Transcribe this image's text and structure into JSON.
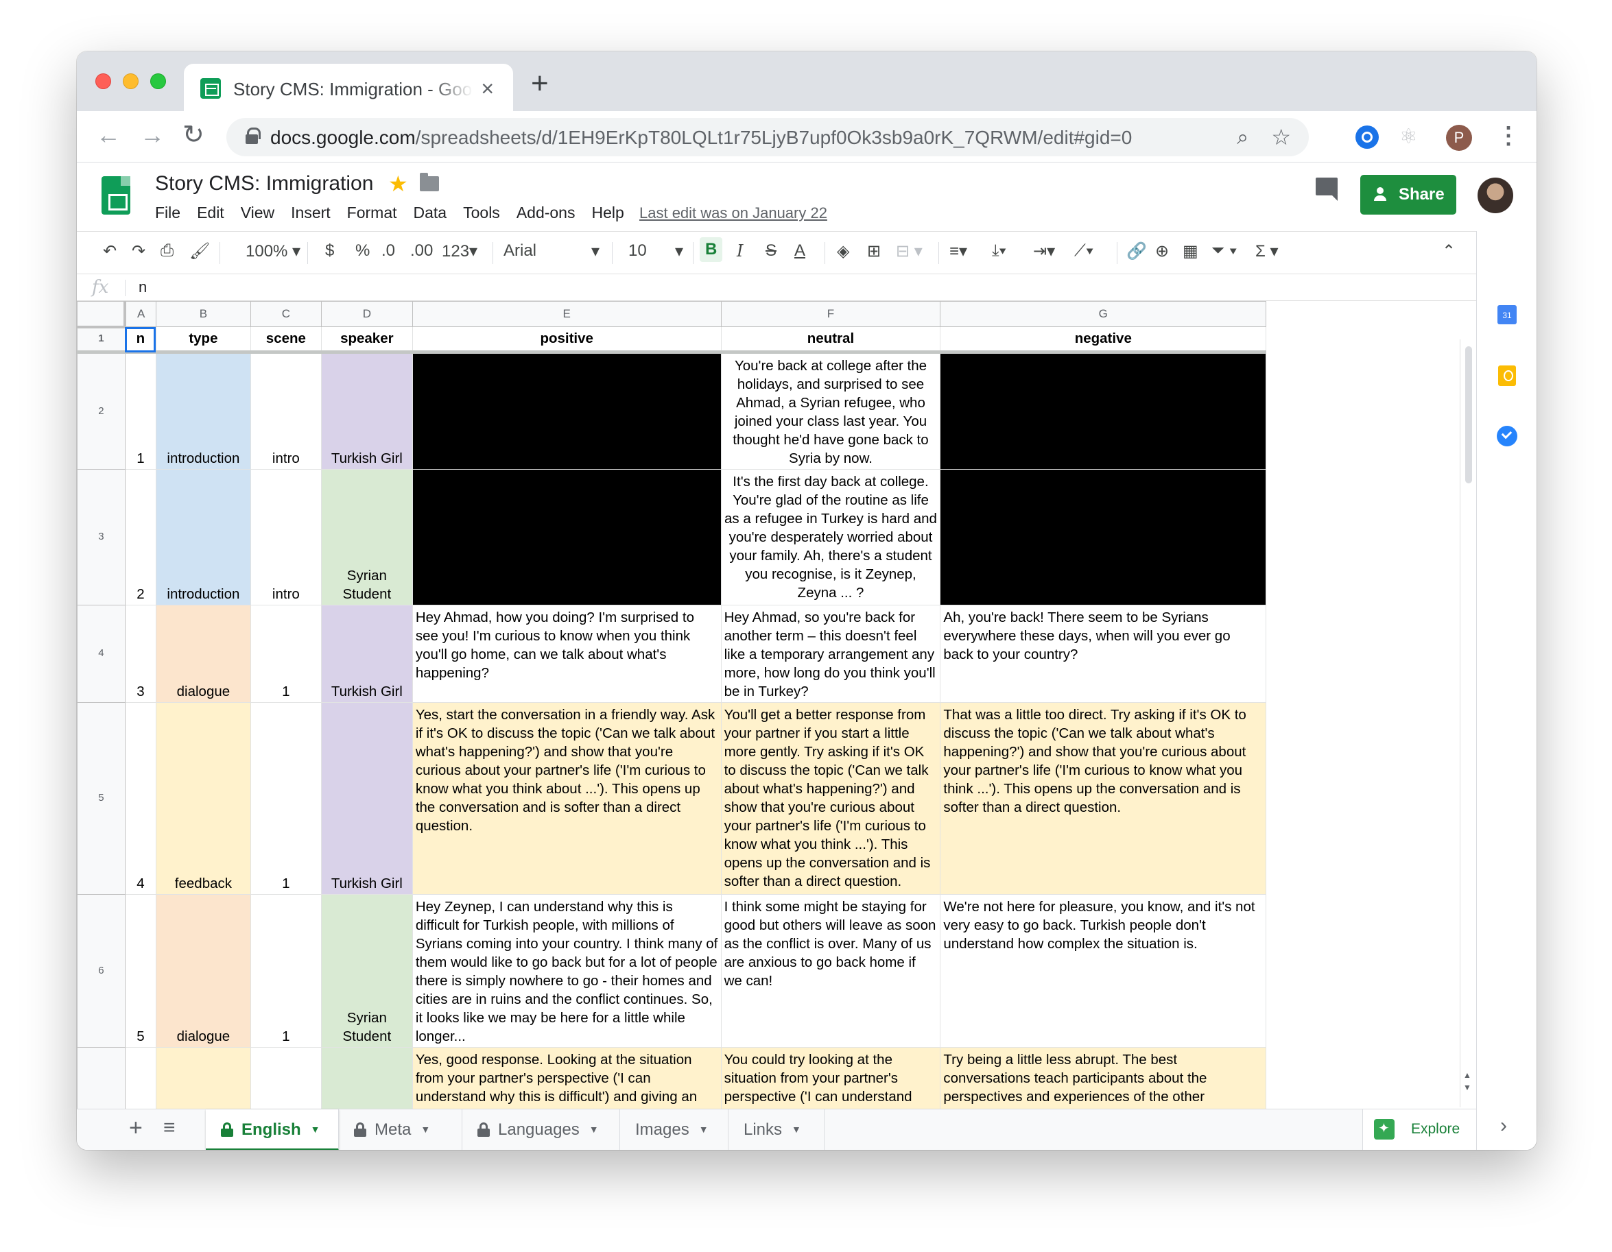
{
  "browser": {
    "tab_title": "Story CMS: Immigration - Google Sheets",
    "url_host": "docs.google.com",
    "url_path": "/spreadsheets/d/1EH9ErKpT80LQLt1r75LjyB7upf0Ok3sb9a0rK_7QRWM/edit#gid=0",
    "profile_initial": "P"
  },
  "doc": {
    "title": "Story CMS: Immigration",
    "menu": [
      "File",
      "Edit",
      "View",
      "Insert",
      "Format",
      "Data",
      "Tools",
      "Add-ons",
      "Help"
    ],
    "last_edit": "Last edit was on January 22",
    "share_label": "Share"
  },
  "format_toolbar": {
    "zoom": "100%",
    "currency": "$",
    "percent": "%",
    "dec_less": ".0",
    "dec_more": ".00",
    "more_formats": "123",
    "font": "Arial",
    "font_size": "10"
  },
  "formula_bar": {
    "fx": "fx",
    "value": "n"
  },
  "grid": {
    "columns": [
      "A",
      "B",
      "C",
      "D",
      "E",
      "F",
      "G"
    ],
    "header_row": [
      "n",
      "type",
      "scene",
      "speaker",
      "positive",
      "neutral",
      "negative"
    ],
    "rows": [
      {
        "row_num": "2",
        "n": "1",
        "type": "introduction",
        "scene": "intro",
        "speaker": "Turkish Girl",
        "positive": "",
        "neutral": "You're back at college after the holidays, and surprised to see Ahmad, a Syrian refugee, who joined your class last year. You thought he'd have gone back to Syria by now.",
        "negative": ""
      },
      {
        "row_num": "3",
        "n": "2",
        "type": "introduction",
        "scene": "intro",
        "speaker": "Syrian Student",
        "positive": "",
        "neutral": "It's the first day back at college. You're glad of the routine as life as a refugee in Turkey is hard and you're desperately worried about your family. Ah, there's a student you recognise, is it Zeynep, Zeyna ... ?",
        "negative": ""
      },
      {
        "row_num": "4",
        "n": "3",
        "type": "dialogue",
        "scene": "1",
        "speaker": "Turkish Girl",
        "positive": "Hey Ahmad, how you doing? I'm surprised to see you! I'm curious to know when you think you'll go home, can we talk about what's happening?",
        "neutral": "Hey Ahmad, so you're back for another term – this doesn't feel like a temporary arrangement any more, how long do you think you'll be in Turkey?",
        "negative": "Ah, you're back! There seem to be Syrians everywhere these days, when will you ever go back to your country?"
      },
      {
        "row_num": "5",
        "n": "4",
        "type": "feedback",
        "scene": "1",
        "speaker": "Turkish Girl",
        "positive": "Yes, start the conversation in a friendly way. Ask if it's OK to discuss the topic ('Can we talk about what's happening?') and show that you're curious about your partner's life ('I'm curious to know what you think about ...'). This opens up the conversation and is softer than a direct question.",
        "neutral": "You'll get a better response from your partner if you start a little more gently. Try asking if it's OK to discuss the topic ('Can we talk about what's happening?') and show that you're curious about your partner's life ('I'm curious to know what you think ...'). This opens up the conversation and is softer than a direct question.",
        "negative": "That was a little too direct. Try asking if it's OK to discuss the topic ('Can we talk about what's happening?') and show that you're curious about your partner's life ('I'm curious to know what you think ...'). This opens up the conversation and is softer than a direct question."
      },
      {
        "row_num": "6",
        "n": "5",
        "type": "dialogue",
        "scene": "1",
        "speaker": "Syrian Student",
        "positive": "Hey Zeynep, I can understand why this is difficult for Turkish people, with millions of Syrians coming into your country. I think many of them would like to go back but for a lot of people there is simply nowhere to go - their homes and cities are in ruins and the conflict continues. So, it looks like we may be here for a little while longer...",
        "neutral": "I think some might be staying for good but others will leave as soon as the conflict is over. Many of us are anxious to go back home if we can!",
        "negative": "We're not here for pleasure, you know, and it's not very easy to go back. Turkish people don't understand how complex the situation is."
      },
      {
        "row_num": "",
        "n": "",
        "type": "",
        "scene": "",
        "speaker": "",
        "positive": "Yes, good response. Looking at the situation from your partner's perspective ('I can understand why this is difficult') and giving an",
        "neutral": "You could try looking at the situation from your partner's perspective ('I can understand",
        "negative": "Try being a little less abrupt. The best conversations teach participants about the perspectives and experiences of the other"
      }
    ]
  },
  "sheet_tabs": [
    "English",
    "Meta",
    "Languages",
    "Images",
    "Links"
  ],
  "explore_label": "Explore",
  "colors": {
    "share_green": "#1e8e3e",
    "active_tab_green": "#188038",
    "selection_blue": "#1a73e8"
  }
}
